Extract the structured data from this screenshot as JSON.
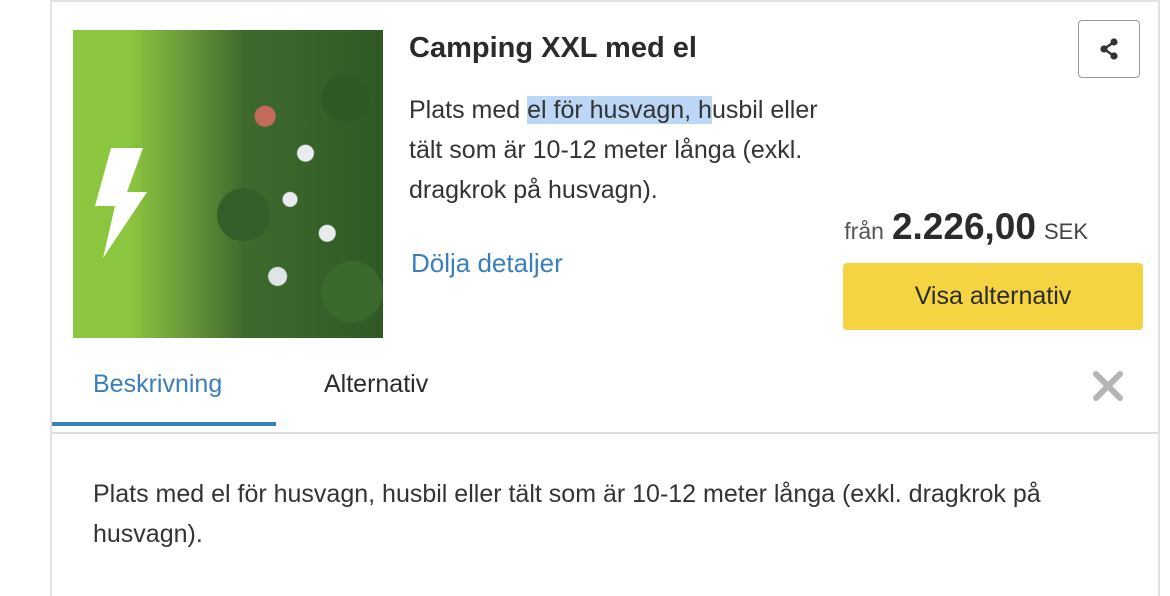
{
  "listing": {
    "title": "Camping XXL med el",
    "desc_before": "Plats med ",
    "desc_highlight": "el för husvagn, h",
    "desc_after": "usbil eller tält som är 10-12 meter långa (exkl. dragkrok på husvagn).",
    "hide_details": "Dölja detaljer",
    "price_prefix": "från",
    "price": "2.226,00",
    "currency": "SEK",
    "cta_label": "Visa alternativ"
  },
  "tabs": [
    {
      "label": "Beskrivning",
      "active": true
    },
    {
      "label": "Alternativ",
      "active": false
    }
  ],
  "description": "Plats med el för husvagn, husbil eller tält som är 10-12 meter långa (exkl. dragkrok på husvagn).",
  "icons": {
    "share": "share-icon",
    "close": "close-icon",
    "thumbnail_badge": "lightning-bolt-icon"
  },
  "colors": {
    "accent": "#3a7fbd",
    "cta": "#f5d442",
    "thumbnail_green": "#8cc63f",
    "highlight": "#bcd6f5"
  }
}
